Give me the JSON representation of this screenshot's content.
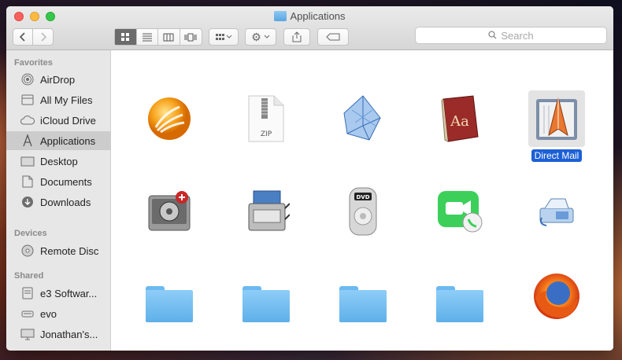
{
  "window": {
    "title": "Applications"
  },
  "toolbar": {
    "back_icon": "chevron-left-icon",
    "forward_icon": "chevron-right-icon"
  },
  "search": {
    "placeholder": "Search"
  },
  "sidebar": {
    "favorites_header": "Favorites",
    "favorites": [
      {
        "label": "AirDrop",
        "icon": "airdrop-icon"
      },
      {
        "label": "All My Files",
        "icon": "files-icon"
      },
      {
        "label": "iCloud Drive",
        "icon": "cloud-icon"
      },
      {
        "label": "Applications",
        "icon": "applications-icon",
        "selected": true
      },
      {
        "label": "Desktop",
        "icon": "desktop-icon"
      },
      {
        "label": "Documents",
        "icon": "documents-icon"
      },
      {
        "label": "Downloads",
        "icon": "downloads-icon"
      }
    ],
    "devices_header": "Devices",
    "devices": [
      {
        "label": "Remote Disc",
        "icon": "disc-icon"
      }
    ],
    "shared_header": "Shared",
    "shared": [
      {
        "label": "e3 Softwar...",
        "icon": "server-icon"
      },
      {
        "label": "evo",
        "icon": "server-icon"
      },
      {
        "label": "Jonathan's...",
        "icon": "computer-icon"
      }
    ]
  },
  "apps": [
    {
      "icon": "burn-app-icon",
      "label": ""
    },
    {
      "icon": "zip-file-icon",
      "label": "",
      "badge": "ZIP"
    },
    {
      "icon": "blueprint-app-icon",
      "label": ""
    },
    {
      "icon": "dictionary-app-icon",
      "label": "",
      "badge": "Aa"
    },
    {
      "icon": "direct-mail-app-icon",
      "label": "Direct Mail",
      "selected": true
    },
    {
      "icon": "disk-utility-app-icon",
      "label": ""
    },
    {
      "icon": "scanner-app-icon",
      "label": ""
    },
    {
      "icon": "dvd-player-app-icon",
      "label": "",
      "badge": "DVD"
    },
    {
      "icon": "facetime-app-icon",
      "label": ""
    },
    {
      "icon": "fax-app-icon",
      "label": ""
    },
    {
      "icon": "folder-icon",
      "label": ""
    },
    {
      "icon": "folder-icon",
      "label": ""
    },
    {
      "icon": "folder-icon",
      "label": ""
    },
    {
      "icon": "folder-icon",
      "label": ""
    },
    {
      "icon": "firefox-app-icon",
      "label": ""
    }
  ]
}
